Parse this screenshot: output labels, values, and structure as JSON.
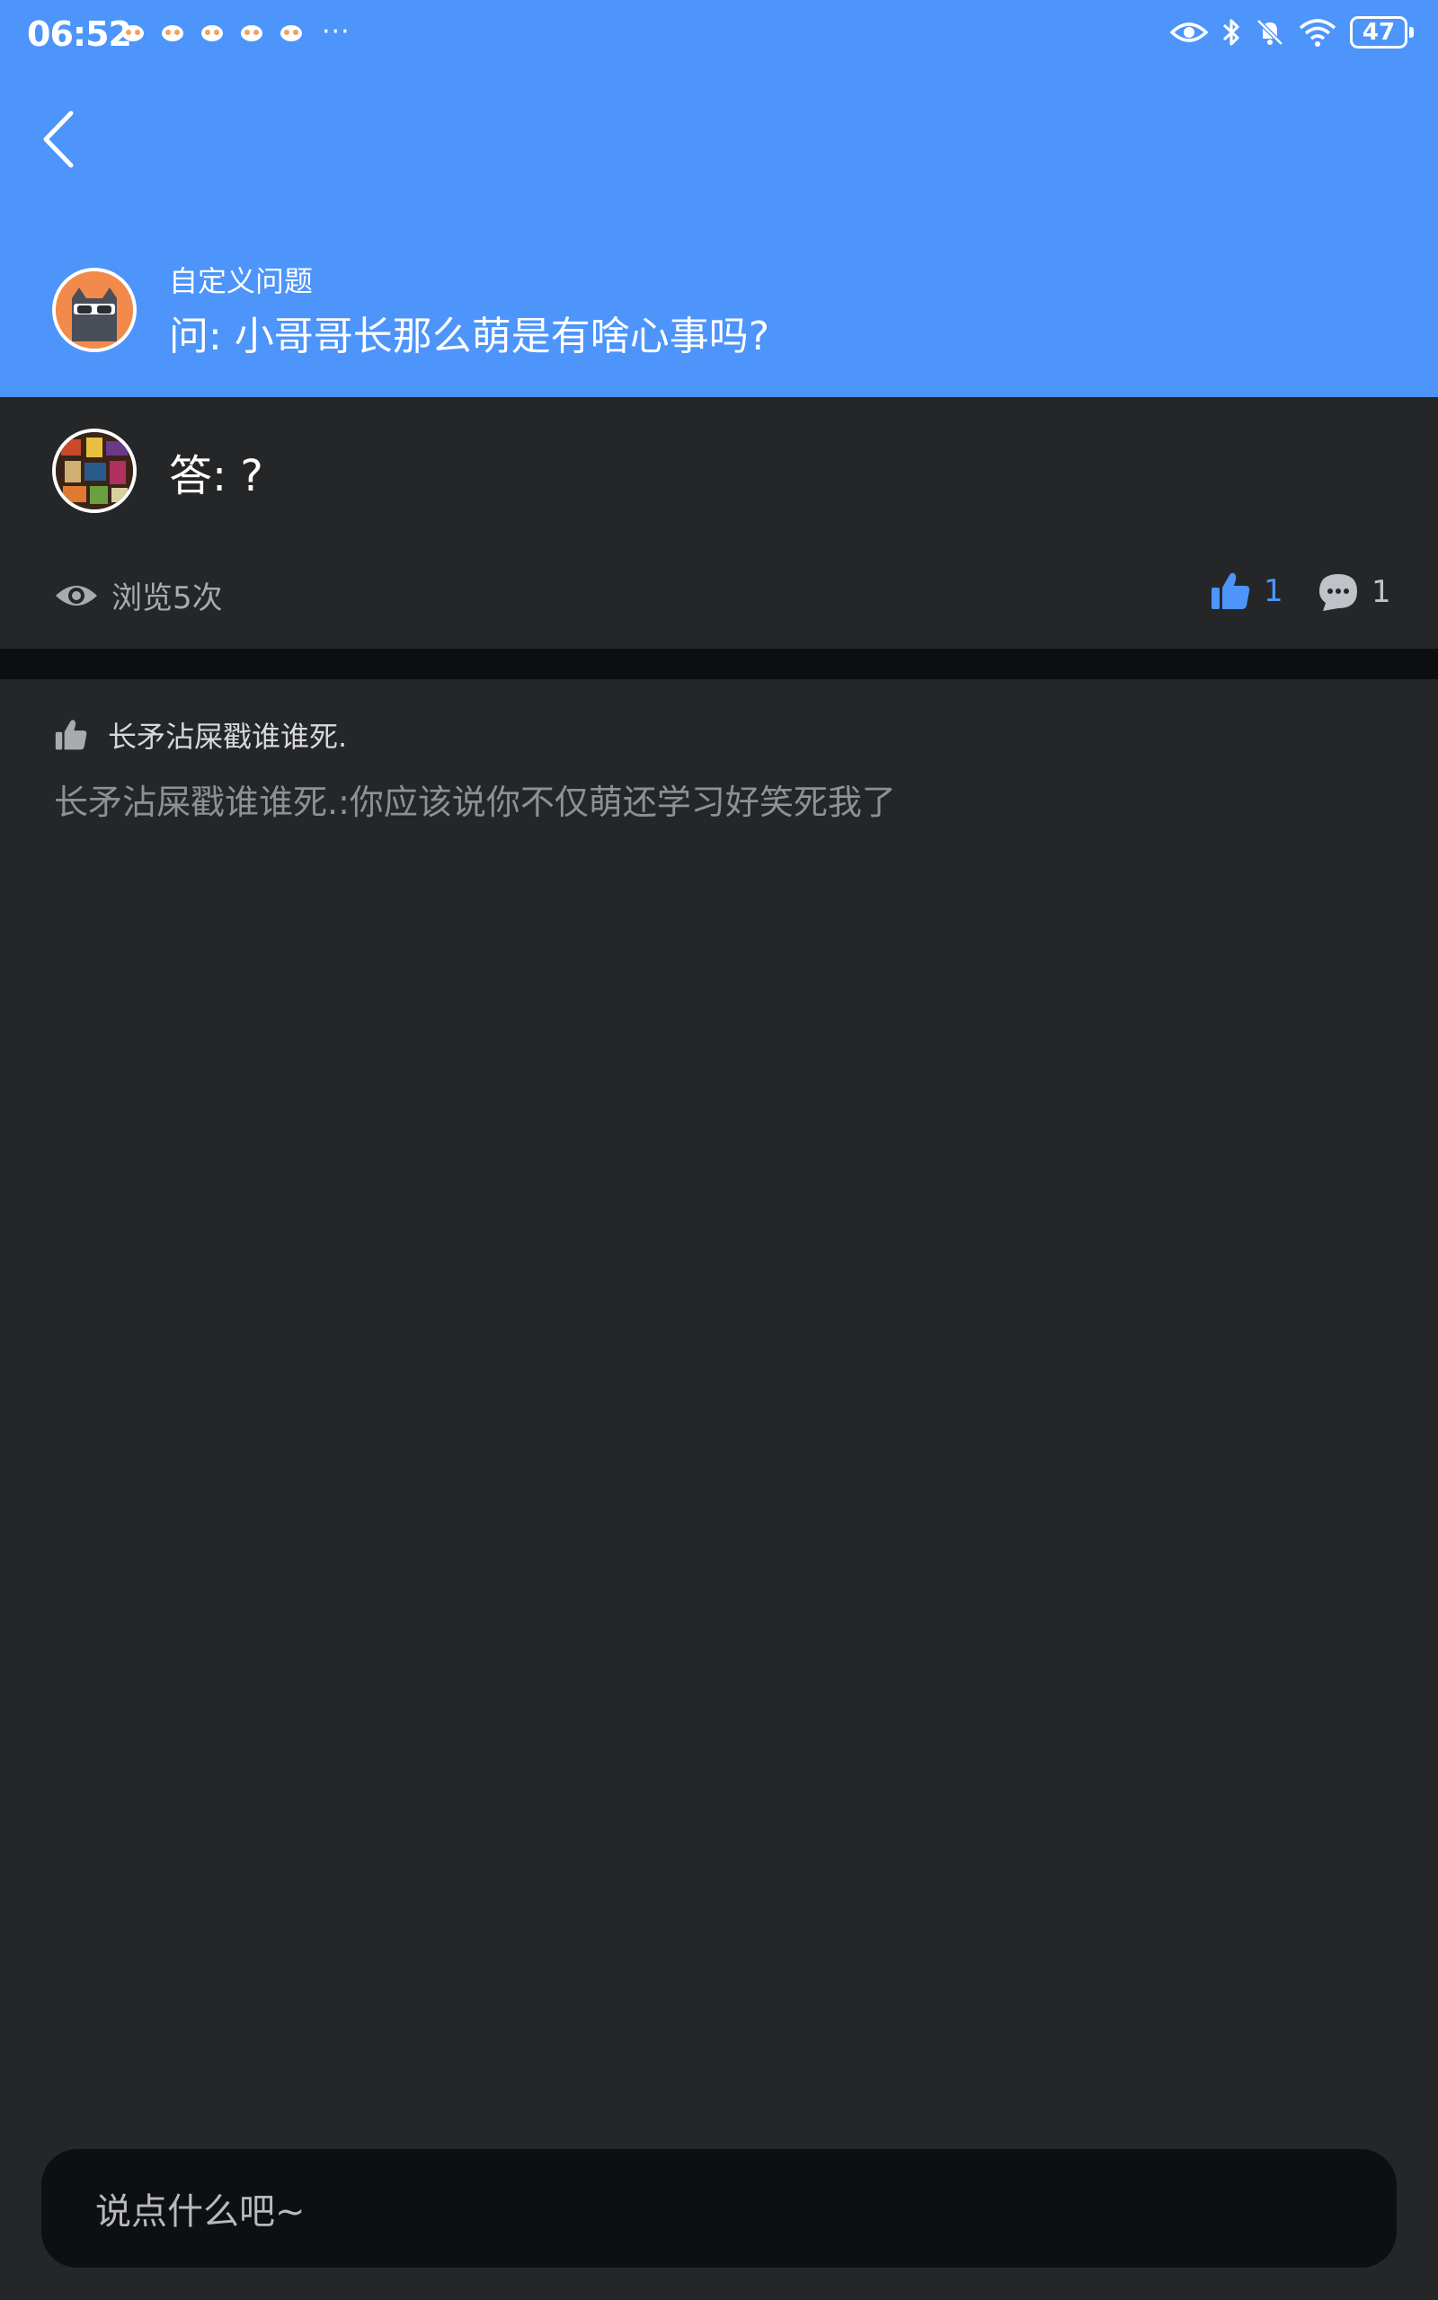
{
  "status_bar": {
    "time": "06:52",
    "more": "···",
    "battery": "47"
  },
  "question": {
    "category": "自定义问题",
    "text": "问: 小哥哥长那么萌是有啥心事吗?"
  },
  "answer": {
    "text": "答: ?"
  },
  "stats": {
    "views": "浏览5次",
    "likes": "1",
    "comments": "1"
  },
  "likes_section": {
    "user": "长矛沾屎戳谁谁死."
  },
  "comments_list": [
    {
      "text": "长矛沾屎戳谁谁死.:你应该说你不仅萌还学习好笑死我了"
    }
  ],
  "input": {
    "placeholder": "说点什么吧~"
  },
  "colors": {
    "header": "#4d94fb",
    "background": "#252628",
    "accent": "#4d94fb"
  }
}
